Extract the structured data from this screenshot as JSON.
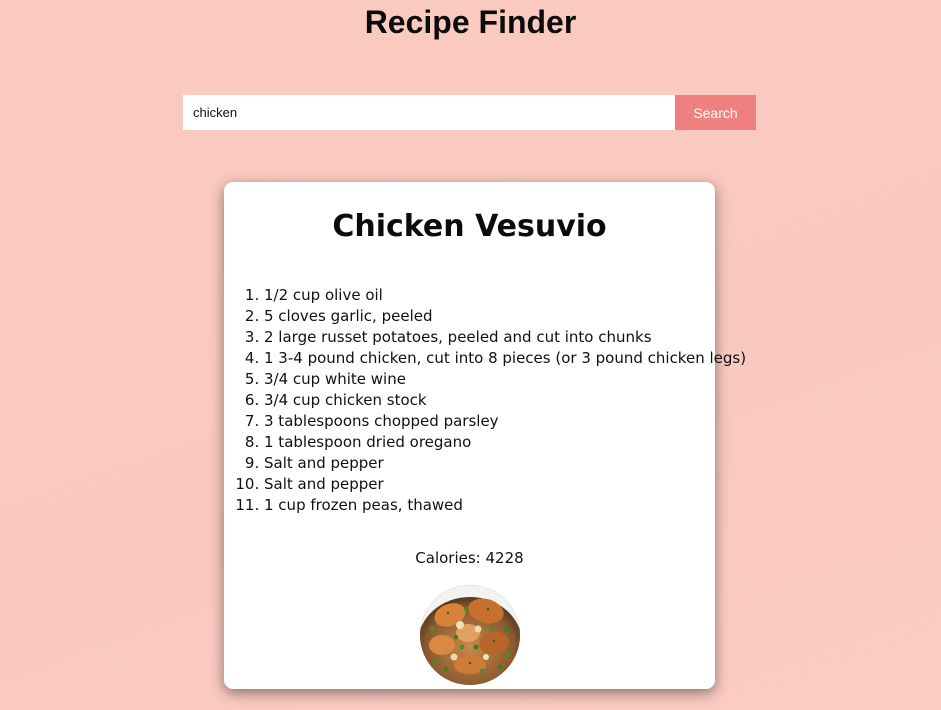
{
  "app": {
    "title": "Recipe Finder"
  },
  "search": {
    "value": "chicken",
    "button_label": "Search"
  },
  "recipe": {
    "title": "Chicken Vesuvio",
    "ingredients": [
      "1/2 cup olive oil",
      "5 cloves garlic, peeled",
      "2 large russet potatoes, peeled and cut into chunks",
      "1 3-4 pound chicken, cut into 8 pieces (or 3 pound chicken legs)",
      "3/4 cup white wine",
      "3/4 cup chicken stock",
      "3 tablespoons chopped parsley",
      "1 tablespoon dried oregano",
      "Salt and pepper",
      "Salt and pepper",
      "1 cup frozen peas, thawed"
    ],
    "calories_text": "Calories: 4228",
    "image_icon": "food-photo"
  },
  "colors": {
    "background": "#fbcbc1",
    "button": "#f08080",
    "card": "#ffffff"
  }
}
